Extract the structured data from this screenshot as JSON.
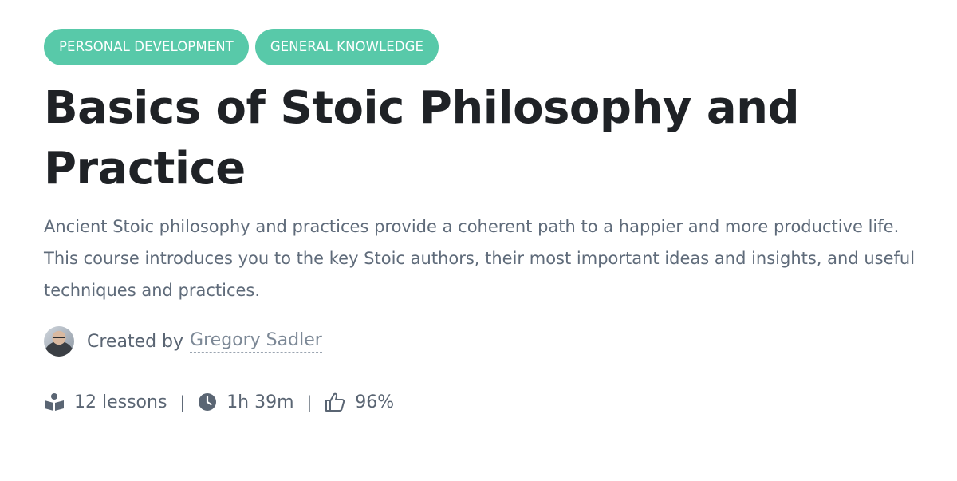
{
  "tags": [
    {
      "label": "PERSONAL DEVELOPMENT"
    },
    {
      "label": "GENERAL KNOWLEDGE"
    }
  ],
  "course": {
    "title": "Basics of Stoic Philosophy and Practice",
    "description": "Ancient Stoic philosophy and practices provide a coherent path to a happier and more productive life. This course introduces you to the key Stoic authors, their most important ideas and insights, and useful techniques and practices."
  },
  "author": {
    "created_label": "Created by",
    "name": "Gregory Sadler"
  },
  "stats": {
    "lessons": "12 lessons",
    "duration": "1h 39m",
    "rating": "96%",
    "separator": "|",
    "icons": {
      "lessons": "reading-book-icon",
      "duration": "clock-icon",
      "rating": "thumbs-up-icon"
    }
  },
  "colors": {
    "tag_background": "#58c9a9",
    "title": "#1f2226",
    "body_text": "#5f6b7a"
  }
}
